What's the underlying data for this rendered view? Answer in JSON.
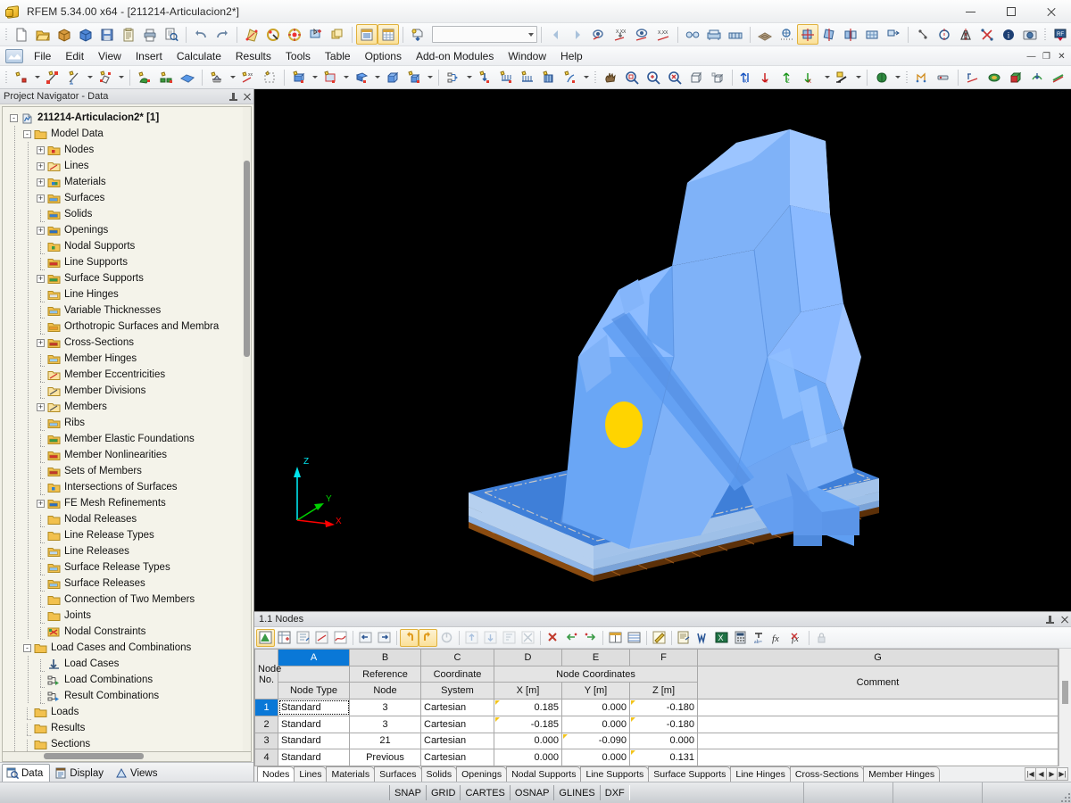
{
  "window": {
    "title": "RFEM 5.34.00 x64 - [211214-Articulacion2*]",
    "app_icon": "rfem-logo-icon",
    "minimize_label": "Minimize",
    "maximize_label": "Maximize",
    "close_label": "Close"
  },
  "menu": {
    "logo": "rfem-menu-logo-icon",
    "items": [
      {
        "label": "File"
      },
      {
        "label": "Edit"
      },
      {
        "label": "View"
      },
      {
        "label": "Insert"
      },
      {
        "label": "Calculate"
      },
      {
        "label": "Results"
      },
      {
        "label": "Tools"
      },
      {
        "label": "Table"
      },
      {
        "label": "Options"
      },
      {
        "label": "Add-on Modules"
      },
      {
        "label": "Window"
      },
      {
        "label": "Help"
      }
    ],
    "doc_min": "—",
    "doc_restore": "❐",
    "doc_close": "✕"
  },
  "toolbar_main": {
    "combo_value": "",
    "combo_placeholder": "",
    "buttons": [
      {
        "name": "new-file-icon",
        "title": "New"
      },
      {
        "name": "open-file-icon",
        "title": "Open"
      },
      {
        "name": "open-package-icon",
        "title": "Open Project"
      },
      {
        "name": "save-package-icon",
        "title": "Save As Package"
      },
      {
        "name": "save-icon",
        "title": "Save"
      },
      {
        "name": "clipboard-icon",
        "title": "Details"
      },
      {
        "name": "print-icon",
        "title": "Print"
      },
      {
        "name": "print-preview-icon",
        "title": "Print Preview"
      },
      {
        "name": "undo-icon",
        "title": "Undo"
      },
      {
        "name": "redo-icon",
        "title": "Redo"
      },
      {
        "name": "edit-model-icon",
        "title": "Edit Model"
      },
      {
        "name": "select-objects-icon",
        "title": "Select"
      },
      {
        "name": "select-special-icon",
        "title": "Special Select"
      },
      {
        "name": "select-rectangle-icon",
        "title": "Rectangle Select"
      },
      {
        "name": "copy-window-icon",
        "title": "Copy"
      },
      {
        "name": "show-table-icon",
        "title": "Show Tables"
      },
      {
        "name": "show-grid-icon",
        "title": "Show Grid Table"
      },
      {
        "name": "load-case-icon",
        "title": "Load Case"
      },
      {
        "name": "prev-case-icon",
        "title": "Previous"
      },
      {
        "name": "next-case-icon",
        "title": "Next"
      },
      {
        "name": "result-display-icon",
        "title": "Results On/Off"
      },
      {
        "name": "result-value-icon",
        "title": "Result Values"
      },
      {
        "name": "result-view-icon",
        "title": "Result View"
      },
      {
        "name": "result-numeric-icon",
        "title": "Numeric Results"
      },
      {
        "name": "glasses-icon",
        "title": "Visibility"
      },
      {
        "name": "render-icon",
        "title": "Rendering"
      },
      {
        "name": "render-multi-icon",
        "title": "Multiple Render"
      },
      {
        "name": "mesh-icon",
        "title": "FE Mesh"
      },
      {
        "name": "mesh-dots-icon",
        "title": "FE Nodes"
      },
      {
        "name": "move-icon",
        "title": "Move/Copy"
      },
      {
        "name": "rotate-icon",
        "title": "Rotate"
      },
      {
        "name": "mirror-icon",
        "title": "Mirror"
      },
      {
        "name": "scale-grid-icon",
        "title": "Scale"
      },
      {
        "name": "project-icon",
        "title": "Project"
      },
      {
        "name": "measure-icon",
        "title": "Measure"
      },
      {
        "name": "axis-symmetry-icon",
        "title": "Axial Symmetry"
      },
      {
        "name": "plane-symmetry-icon",
        "title": "Plane Symmetry"
      },
      {
        "name": "intersect-icon",
        "title": "Intersect"
      },
      {
        "name": "info-icon",
        "title": "Info"
      },
      {
        "name": "camera-icon",
        "title": "Screenshot"
      },
      {
        "name": "addon-icon",
        "title": "Add-on"
      }
    ]
  },
  "toolbar_model": {
    "buttons": [
      {
        "name": "new-node-icon",
        "title": "New Node"
      },
      {
        "name": "new-line-icon",
        "title": "New Line"
      },
      {
        "name": "new-line-dim-icon",
        "title": "New Dimension Line"
      },
      {
        "name": "new-polyline-icon",
        "title": "New Polyline"
      },
      {
        "name": "new-material-icon",
        "title": "New Material"
      },
      {
        "name": "new-thickness-icon",
        "title": "New Thickness"
      },
      {
        "name": "new-surface-icon",
        "title": "New Surface"
      },
      {
        "name": "new-support-icon",
        "title": "New Nodal Support"
      },
      {
        "name": "new-release-icon",
        "title": "New Release"
      },
      {
        "name": "new-mesh-refine-icon",
        "title": "New Mesh Refinement"
      },
      {
        "name": "new-solid-icon",
        "title": "New Solid"
      },
      {
        "name": "new-opening-icon",
        "title": "New Opening"
      },
      {
        "name": "new-member-icon",
        "title": "New Member"
      },
      {
        "name": "new-cube-icon",
        "title": "New Block"
      },
      {
        "name": "new-copy-icon",
        "title": "New Copy"
      },
      {
        "name": "new-connect-icon",
        "title": "New Connection"
      },
      {
        "name": "new-load-icon",
        "title": "New Load"
      },
      {
        "name": "new-line-load-icon",
        "title": "New Line Load"
      },
      {
        "name": "new-surface-load-icon",
        "title": "New Surface Load"
      },
      {
        "name": "new-free-load-icon",
        "title": "New Free Load"
      },
      {
        "name": "new-imperfection-icon",
        "title": "New Imperfection"
      },
      {
        "name": "pan-hand-icon",
        "title": "Pan"
      },
      {
        "name": "zoom-window-icon",
        "title": "Zoom Window"
      },
      {
        "name": "zoom-all-icon",
        "title": "Zoom All"
      },
      {
        "name": "zoom-reset-icon",
        "title": "Reset Zoom"
      },
      {
        "name": "view-box-icon",
        "title": "View Box"
      },
      {
        "name": "view-iso-icon",
        "title": "Isometric View"
      },
      {
        "name": "view-x-icon",
        "title": "View in X"
      },
      {
        "name": "view-y-icon",
        "title": "View in Y"
      },
      {
        "name": "view-z-icon",
        "title": "View in Z"
      },
      {
        "name": "view-negx-icon",
        "title": "View in -X"
      },
      {
        "name": "view-plane-icon",
        "title": "View Plane"
      },
      {
        "name": "render-solid-icon",
        "title": "Render Solid"
      },
      {
        "name": "line-model-icon",
        "title": "Wireframe"
      },
      {
        "name": "section-icon",
        "title": "Section"
      },
      {
        "name": "result-diagram-icon",
        "title": "Result Diagram"
      },
      {
        "name": "color-surface-icon",
        "title": "Color Surfaces"
      },
      {
        "name": "color-solid-icon",
        "title": "Color Solids"
      },
      {
        "name": "deform-icon",
        "title": "Deformation"
      },
      {
        "name": "stress-icon",
        "title": "Stress"
      },
      {
        "name": "panel-colors-icon",
        "title": "Panel"
      },
      {
        "name": "smooth-icon",
        "title": "Smoothing"
      },
      {
        "name": "table-result-icon",
        "title": "Result Table"
      }
    ]
  },
  "navigator": {
    "title": "Project Navigator - Data",
    "pin_icon": "pin-icon",
    "close_icon": "close-icon",
    "tree": [
      {
        "label": "211214-Articulacion2* [1]",
        "depth": 0,
        "expander": "-",
        "icon": "model-file-icon",
        "bold": true
      },
      {
        "label": "Model Data",
        "depth": 1,
        "expander": "-",
        "icon": "folder-icon"
      },
      {
        "label": "Nodes",
        "depth": 2,
        "expander": "+",
        "icon": "node-folder-icon"
      },
      {
        "label": "Lines",
        "depth": 2,
        "expander": "+",
        "icon": "line-folder-icon"
      },
      {
        "label": "Materials",
        "depth": 2,
        "expander": "+",
        "icon": "material-folder-icon"
      },
      {
        "label": "Surfaces",
        "depth": 2,
        "expander": "+",
        "icon": "surface-folder-icon"
      },
      {
        "label": "Solids",
        "depth": 2,
        "expander": "",
        "icon": "solid-folder-icon"
      },
      {
        "label": "Openings",
        "depth": 2,
        "expander": "+",
        "icon": "opening-folder-icon"
      },
      {
        "label": "Nodal Supports",
        "depth": 2,
        "expander": "",
        "icon": "nodal-support-folder-icon"
      },
      {
        "label": "Line Supports",
        "depth": 2,
        "expander": "",
        "icon": "line-support-folder-icon"
      },
      {
        "label": "Surface Supports",
        "depth": 2,
        "expander": "+",
        "icon": "surface-support-folder-icon"
      },
      {
        "label": "Line Hinges",
        "depth": 2,
        "expander": "",
        "icon": "line-hinge-folder-icon"
      },
      {
        "label": "Variable Thicknesses",
        "depth": 2,
        "expander": "",
        "icon": "thickness-folder-icon"
      },
      {
        "label": "Orthotropic Surfaces and Membra",
        "depth": 2,
        "expander": "",
        "icon": "ortho-folder-icon"
      },
      {
        "label": "Cross-Sections",
        "depth": 2,
        "expander": "+",
        "icon": "cross-section-folder-icon"
      },
      {
        "label": "Member Hinges",
        "depth": 2,
        "expander": "",
        "icon": "member-hinge-folder-icon"
      },
      {
        "label": "Member Eccentricities",
        "depth": 2,
        "expander": "",
        "icon": "eccentricity-folder-icon"
      },
      {
        "label": "Member Divisions",
        "depth": 2,
        "expander": "",
        "icon": "division-folder-icon"
      },
      {
        "label": "Members",
        "depth": 2,
        "expander": "+",
        "icon": "member-folder-icon"
      },
      {
        "label": "Ribs",
        "depth": 2,
        "expander": "",
        "icon": "rib-folder-icon"
      },
      {
        "label": "Member Elastic Foundations",
        "depth": 2,
        "expander": "",
        "icon": "foundation-folder-icon"
      },
      {
        "label": "Member Nonlinearities",
        "depth": 2,
        "expander": "",
        "icon": "nonlinearity-folder-icon"
      },
      {
        "label": "Sets of Members",
        "depth": 2,
        "expander": "",
        "icon": "member-set-folder-icon"
      },
      {
        "label": "Intersections of Surfaces",
        "depth": 2,
        "expander": "",
        "icon": "intersection-folder-icon"
      },
      {
        "label": "FE Mesh Refinements",
        "depth": 2,
        "expander": "+",
        "icon": "fe-mesh-folder-icon"
      },
      {
        "label": "Nodal Releases",
        "depth": 2,
        "expander": "",
        "icon": "folder-icon"
      },
      {
        "label": "Line Release Types",
        "depth": 2,
        "expander": "",
        "icon": "folder-icon"
      },
      {
        "label": "Line Releases",
        "depth": 2,
        "expander": "",
        "icon": "line-release-folder-icon"
      },
      {
        "label": "Surface Release Types",
        "depth": 2,
        "expander": "",
        "icon": "surface-release-folder-icon"
      },
      {
        "label": "Surface Releases",
        "depth": 2,
        "expander": "",
        "icon": "surface-release-folder-icon"
      },
      {
        "label": "Connection of Two Members",
        "depth": 2,
        "expander": "",
        "icon": "folder-icon"
      },
      {
        "label": "Joints",
        "depth": 2,
        "expander": "",
        "icon": "folder-icon"
      },
      {
        "label": "Nodal Constraints",
        "depth": 2,
        "expander": "",
        "icon": "nodal-constraint-folder-icon"
      },
      {
        "label": "Load Cases and Combinations",
        "depth": 1,
        "expander": "-",
        "icon": "folder-icon"
      },
      {
        "label": "Load Cases",
        "depth": 2,
        "expander": "",
        "icon": "load-case-icon"
      },
      {
        "label": "Load Combinations",
        "depth": 2,
        "expander": "",
        "icon": "load-combination-icon"
      },
      {
        "label": "Result Combinations",
        "depth": 2,
        "expander": "",
        "icon": "result-combination-icon"
      },
      {
        "label": "Loads",
        "depth": 1,
        "expander": "",
        "icon": "folder-icon"
      },
      {
        "label": "Results",
        "depth": 1,
        "expander": "",
        "icon": "folder-icon"
      },
      {
        "label": "Sections",
        "depth": 1,
        "expander": "",
        "icon": "folder-icon"
      }
    ],
    "tabs": [
      {
        "label": "Data",
        "icon": "data-tab-icon",
        "selected": true
      },
      {
        "label": "Display",
        "icon": "display-tab-icon",
        "selected": false
      },
      {
        "label": "Views",
        "icon": "views-tab-icon",
        "selected": false
      }
    ]
  },
  "viewport": {
    "background_color": "#000000",
    "model_color": "#6aa6f5",
    "model_color_dark": "#4e86d8",
    "model_color_light": "#8dbcff",
    "base_plate_color": "#3f7fd8",
    "timber_color": "#8a4b10",
    "highlight_circle_color": "#ffd400",
    "axes": [
      {
        "label": "Z",
        "color": "#00e5ee"
      },
      {
        "label": "Y",
        "color": "#00d000"
      },
      {
        "label": "X",
        "color": "#ff0000"
      }
    ]
  },
  "table_panel": {
    "title": "1.1 Nodes",
    "pin_icon": "pin-icon",
    "close_icon": "close-icon",
    "toolbar_buttons": [
      {
        "name": "table-edit-icon",
        "active": true
      },
      {
        "name": "table-insert-icon",
        "active": false
      },
      {
        "name": "table-import-icon",
        "active": false
      },
      {
        "name": "table-export-icon",
        "active": false
      },
      {
        "name": "table-chart-icon",
        "active": false
      },
      {
        "name": "table-prev-icon",
        "active": false
      },
      {
        "name": "table-next-icon",
        "active": false
      },
      {
        "name": "table-undo-icon",
        "active": true
      },
      {
        "name": "table-redo-icon",
        "active": true
      },
      {
        "name": "table-refresh-icon",
        "active": false
      },
      {
        "name": "table-up-icon",
        "active": false
      },
      {
        "name": "table-down-icon",
        "active": false
      },
      {
        "name": "table-sort-icon",
        "active": false
      },
      {
        "name": "table-clear-icon",
        "active": false
      },
      {
        "name": "table-delete-row-icon",
        "active": false
      },
      {
        "name": "table-del-left-icon",
        "active": false
      },
      {
        "name": "table-del-right-icon",
        "active": false
      },
      {
        "name": "table-column-icon",
        "active": false
      },
      {
        "name": "table-rows-icon",
        "active": false
      },
      {
        "name": "table-edit-cell-icon",
        "active": false
      },
      {
        "name": "table-print-icon",
        "active": false
      },
      {
        "name": "table-word-icon",
        "active": false
      },
      {
        "name": "table-excel-icon",
        "active": false
      },
      {
        "name": "table-calc-icon",
        "active": false
      },
      {
        "name": "table-abc-icon",
        "active": false
      },
      {
        "name": "table-fx-icon",
        "active": false
      },
      {
        "name": "table-fx-clear-icon",
        "active": false
      },
      {
        "name": "table-lock-icon",
        "active": false
      }
    ],
    "column_letters": [
      "",
      "A",
      "B",
      "C",
      "D",
      "E",
      "F",
      "G"
    ],
    "selected_column_letter": "A",
    "group_header": "Node Coordinates",
    "headers_top": [
      "Node",
      "",
      "Reference",
      "Coordinate",
      "X [m]",
      "Y [m]",
      "Z [m]",
      ""
    ],
    "headers_bottom": [
      "No.",
      "Node Type",
      "Node",
      "System",
      "",
      "",
      "",
      "Comment"
    ],
    "rows": [
      {
        "no": "1",
        "node_type": "Standard",
        "reference_node": "3",
        "coordinate_system": "Cartesian",
        "x": "0.185",
        "y": "0.000",
        "z": "-0.180",
        "comment": "",
        "selected": true
      },
      {
        "no": "2",
        "node_type": "Standard",
        "reference_node": "3",
        "coordinate_system": "Cartesian",
        "x": "-0.185",
        "y": "0.000",
        "z": "-0.180",
        "comment": "",
        "selected": false
      },
      {
        "no": "3",
        "node_type": "Standard",
        "reference_node": "21",
        "coordinate_system": "Cartesian",
        "x": "0.000",
        "y": "-0.090",
        "z": "0.000",
        "comment": "",
        "selected": false
      },
      {
        "no": "4",
        "node_type": "Standard",
        "reference_node": "Previous",
        "coordinate_system": "Cartesian",
        "x": "0.000",
        "y": "0.000",
        "z": "0.131",
        "comment": "",
        "selected": false
      }
    ],
    "tabs": [
      {
        "label": "Nodes",
        "selected": true
      },
      {
        "label": "Lines",
        "selected": false
      },
      {
        "label": "Materials",
        "selected": false
      },
      {
        "label": "Surfaces",
        "selected": false
      },
      {
        "label": "Solids",
        "selected": false
      },
      {
        "label": "Openings",
        "selected": false
      },
      {
        "label": "Nodal Supports",
        "selected": false
      },
      {
        "label": "Line Supports",
        "selected": false
      },
      {
        "label": "Surface Supports",
        "selected": false
      },
      {
        "label": "Line Hinges",
        "selected": false
      },
      {
        "label": "Cross-Sections",
        "selected": false
      },
      {
        "label": "Member Hinges",
        "selected": false
      }
    ],
    "tab_nav": [
      "|◀",
      "◀",
      "▶",
      "▶|"
    ]
  },
  "statusbar": {
    "cells": [
      {
        "label": "SNAP"
      },
      {
        "label": "GRID"
      },
      {
        "label": "CARTES"
      },
      {
        "label": "OSNAP"
      },
      {
        "label": "GLINES"
      },
      {
        "label": "DXF"
      }
    ]
  }
}
